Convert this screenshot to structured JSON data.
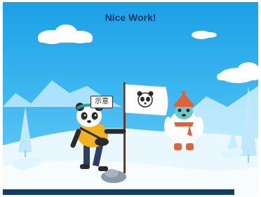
{
  "header": {
    "title": "Nice Work!"
  },
  "speech_bubble": {
    "text": "示意"
  },
  "flag": {
    "icon": "panda-face-icon"
  },
  "colors": {
    "sky_top": "#1ba0e6",
    "sky_bottom": "#6fd0f6",
    "title_text": "#16365c",
    "panda_shirt": "#f2b11e",
    "yeti_hat": "#e0623a",
    "bottom_bar": "#0e3f66"
  }
}
